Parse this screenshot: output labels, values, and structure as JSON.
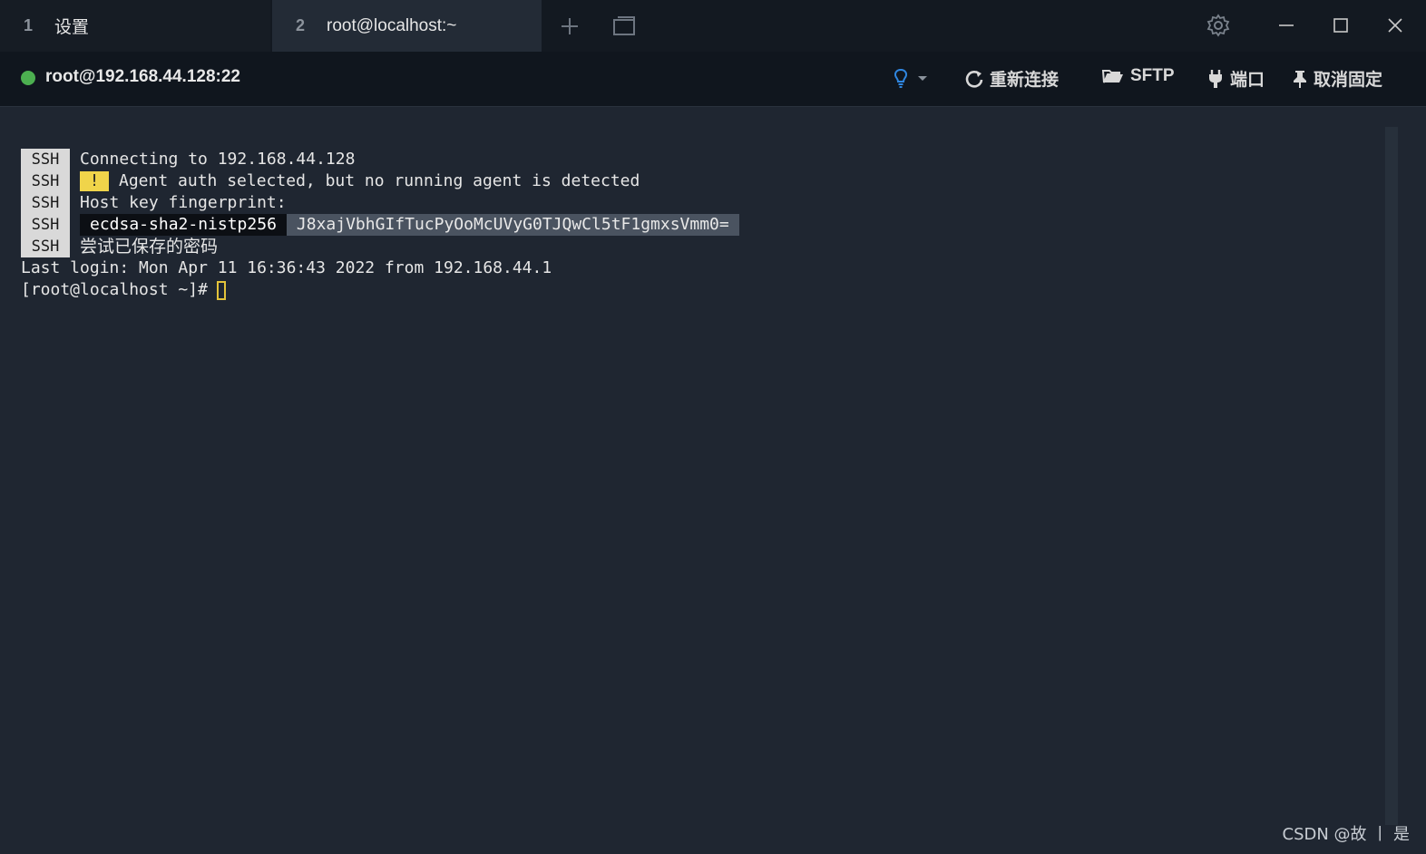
{
  "tabs": [
    {
      "number": "1",
      "label": "设置"
    },
    {
      "number": "2",
      "label": "root@localhost:~"
    }
  ],
  "toolbar": {
    "connection": "root@192.168.44.128:22",
    "status_color": "#4caf50",
    "reconnect_label": "重新连接",
    "sftp_label": "SFTP",
    "port_label": "端口",
    "unpin_label": "取消固定"
  },
  "terminal": {
    "ssh_tag": "SSH",
    "lines": [
      "Connecting to 192.168.44.128",
      "Agent auth selected, but no running agent is detected",
      "Host key fingerprint:",
      "",
      "尝试已保存的密码",
      "Last login: Mon Apr 11 16:36:43 2022 from 192.168.44.1",
      "[root@localhost ~]#"
    ],
    "warn_symbol": "!",
    "fingerprint_algo": "ecdsa-sha2-nistp256",
    "fingerprint_hash": "J8xajVbhGIfTucPyOoMcUVyG0TJQwCl5tF1gmxsVmm0="
  },
  "watermark": "CSDN @故 丨 是"
}
